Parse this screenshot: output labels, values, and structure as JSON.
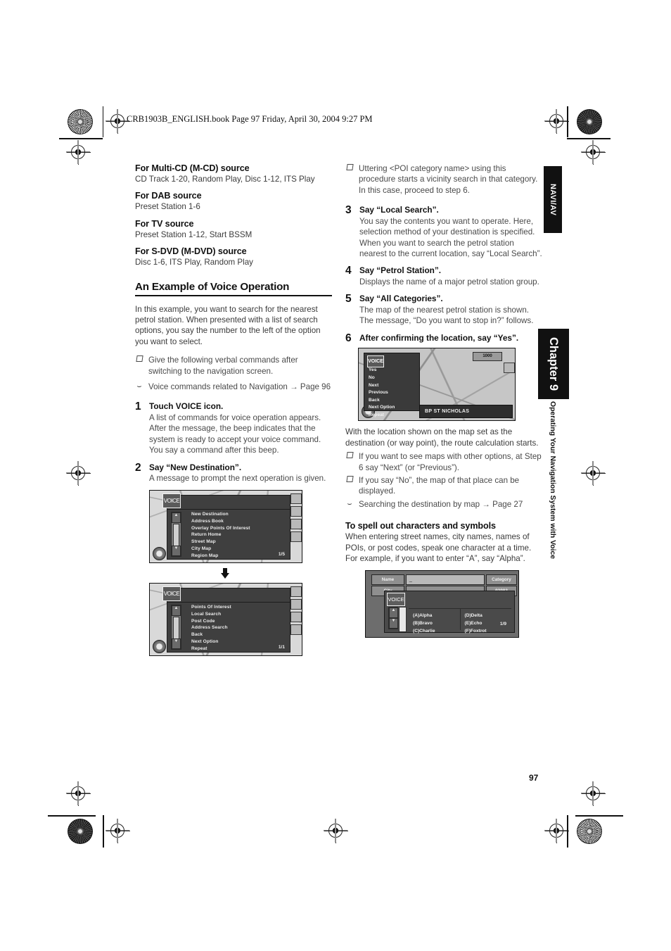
{
  "header": {
    "file_line": "CRB1903B_ENGLISH.book  Page 97  Friday, April 30, 2004  9:27 PM"
  },
  "page_number": "97",
  "side_tabs": {
    "naviav": "NAVI/AV",
    "chapter": "Chapter 9",
    "subtitle": "Operating Your Navigation System with Voice"
  },
  "left_column": {
    "sources": [
      {
        "heading": "For Multi-CD (M-CD) source",
        "body": "CD Track 1-20, Random Play, Disc 1-12, ITS Play"
      },
      {
        "heading": "For DAB source",
        "body": "Preset Station 1-6"
      },
      {
        "heading": "For TV source",
        "body": "Preset Station 1-12, Start BSSM"
      },
      {
        "heading": "For S-DVD (M-DVD) source",
        "body": "Disc 1-6, ITS Play, Random Play"
      }
    ],
    "section_title": "An Example of Voice Operation",
    "intro": "In this example, you want to search for the nearest petrol station. When presented with a list of search options, you say the number to the left of the option you want to select.",
    "notes": [
      {
        "glyph": "square",
        "text": "Give the following verbal commands after switching to the navigation screen."
      },
      {
        "glyph": "hook",
        "text": "Voice commands related to Navigation → Page 96"
      }
    ],
    "steps": [
      {
        "num": "1",
        "lead": "Touch VOICE icon.",
        "desc": "A list of commands for voice operation appears. After the message, the beep indicates that the system is ready to accept your voice command. You say a command after this beep."
      },
      {
        "num": "2",
        "lead": "Say “New Destination”.",
        "desc": "A message to prompt the next operation is given."
      }
    ],
    "screenshot_1": {
      "voice_icon": "VOICE",
      "items": [
        "New Destination",
        "Address Book",
        "Overlay Points Of Interest",
        "Return Home",
        "Street Map",
        "City Map",
        "Region Map"
      ],
      "page_indicator": "1/5",
      "scroll_up": "▲",
      "scroll_down": "▼"
    },
    "transition_arrow": "down-arrow",
    "screenshot_2": {
      "voice_icon": "VOICE",
      "items": [
        "Points Of Interest",
        "Local Search",
        "Post Code",
        "Address Search",
        "Back",
        "Next Option",
        "Repeat"
      ],
      "page_indicator": "1/1",
      "scroll_up": "▲",
      "scroll_down": "▼"
    }
  },
  "right_column": {
    "top_note": {
      "glyph": "square",
      "text": "Uttering <POI category name> using this procedure starts a vicinity search in that category. In this case, proceed to step 6."
    },
    "steps": [
      {
        "num": "3",
        "lead": "Say “Local Search”.",
        "desc": "You say the contents you want to operate. Here, selection method of your destination is specified. When you want to search the petrol station nearest to the current location, say “Local Search”."
      },
      {
        "num": "4",
        "lead": "Say “Petrol Station”.",
        "desc": "Displays the name of a major petrol station group."
      },
      {
        "num": "5",
        "lead": "Say “All Categories”.",
        "desc": "The map of the nearest petrol station is shown. The message, “Do you want to stop in?” follows."
      },
      {
        "num": "6",
        "lead": "After confirming the location, say “Yes”.",
        "desc": ""
      }
    ],
    "screenshot_map": {
      "voice_icon": "VOICE",
      "menu_items": [
        "Yes",
        "No",
        "Next",
        "Previous",
        "Back",
        "Next Option",
        "Repeat"
      ],
      "poi_label": "BP ST NICHOLAS",
      "zoom_label": "1000"
    },
    "after_map_text": "With the location shown on the map set as the destination (or way point), the route calculation starts.",
    "after_map_notes": [
      {
        "glyph": "square",
        "text": "If you want to see maps with other options, at Step 6 say “Next” (or “Previous”)."
      },
      {
        "glyph": "square",
        "text": "If you say “No”, the map of that place can be displayed."
      },
      {
        "glyph": "hook",
        "text": "Searching the destination by map → Page 27"
      }
    ],
    "spell_section": {
      "heading": "To spell out characters and symbols",
      "body": "When entering street names, city names, names of POIs, or post codes, speak one character at a time. For example, if you want to enter “A”, say “Alpha”."
    },
    "screenshot_spell": {
      "voice_icon": "VOICE",
      "btn_name": "Name",
      "btn_city": "City",
      "btn_category": "Category",
      "code_value": "93983",
      "input_value": "_",
      "left_items": [
        "(A)Alpha",
        "(B)Bravo",
        "(C)Charlie"
      ],
      "right_items": [
        "(D)Delta",
        "(E)Echo",
        "(F)Foxtrot"
      ],
      "page_indicator": "1/9"
    }
  }
}
